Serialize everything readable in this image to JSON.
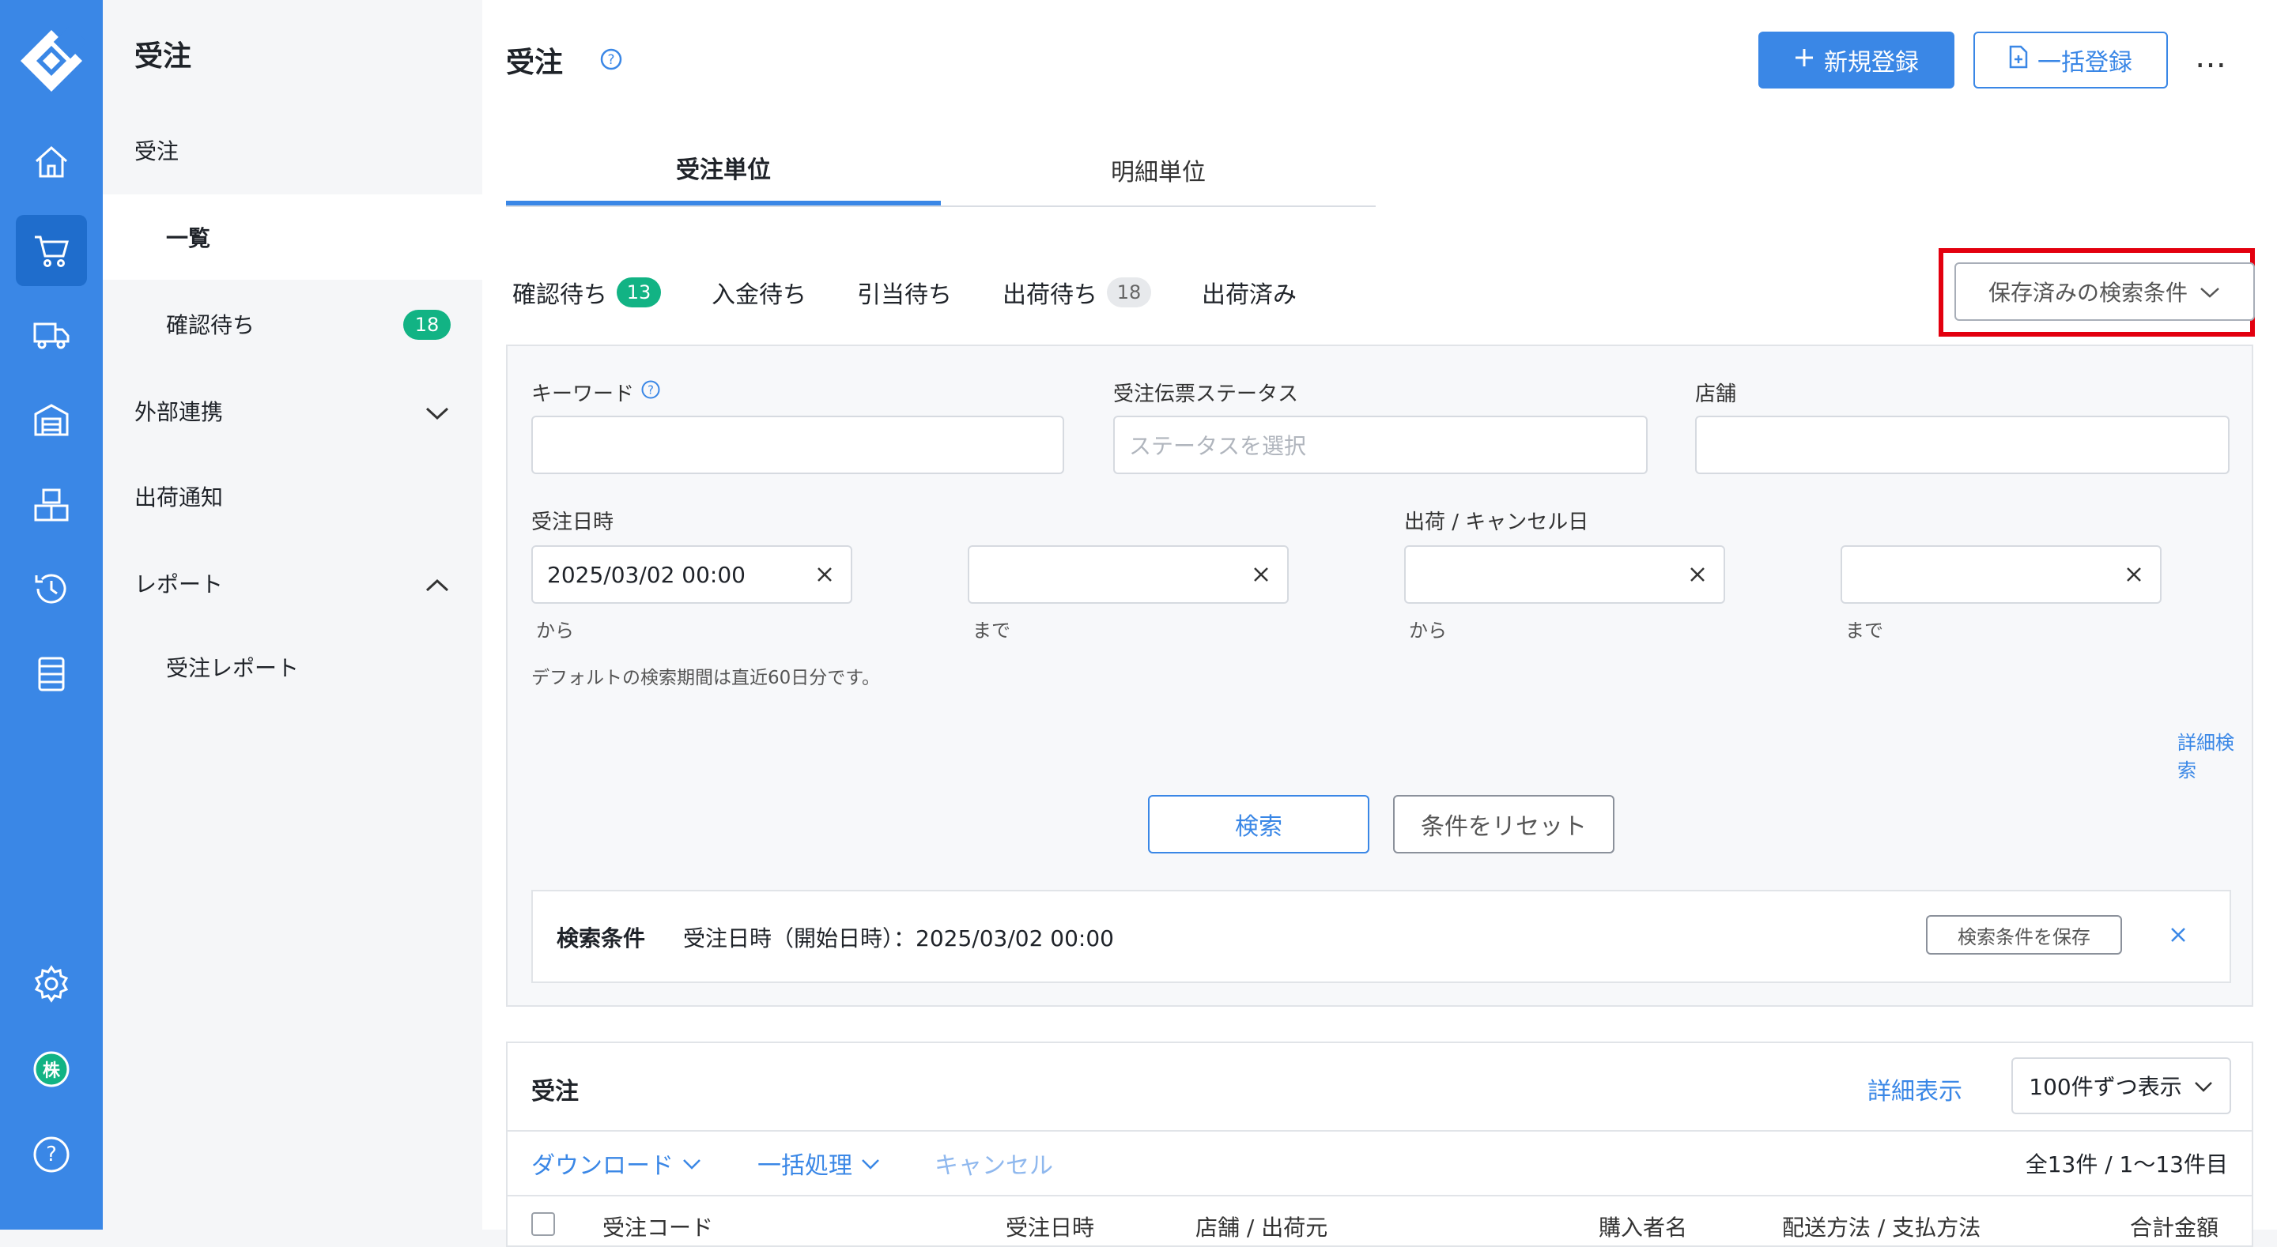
{
  "sidebar": {
    "title": "受注",
    "items": [
      {
        "label": "受注"
      },
      {
        "label": "一覧"
      },
      {
        "label": "確認待ち",
        "badge": "18"
      },
      {
        "label": "外部連携"
      },
      {
        "label": "出荷通知"
      },
      {
        "label": "レポート"
      },
      {
        "label": "受注レポート"
      }
    ]
  },
  "rail": {
    "logo": "app-logo",
    "icons": [
      "home-icon",
      "cart-icon",
      "truck-icon",
      "warehouse-icon",
      "boxes-icon",
      "history-icon",
      "server-icon",
      "gear-icon",
      "company-avatar",
      "help-icon"
    ],
    "company_avatar_label": "株",
    "help_label": "?"
  },
  "header": {
    "title": "受注",
    "new_button": "新規登録",
    "bulk_button": "一括登録",
    "more": "…"
  },
  "tabs": [
    {
      "label": "受注単位",
      "active": true
    },
    {
      "label": "明細単位",
      "active": false
    }
  ],
  "status_tabs": [
    {
      "label": "確認待ち",
      "count": "13",
      "style": "green"
    },
    {
      "label": "入金待ち"
    },
    {
      "label": "引当待ち"
    },
    {
      "label": "出荷待ち",
      "count": "18",
      "style": "gray"
    },
    {
      "label": "出荷済み"
    }
  ],
  "saved_search": {
    "label": "保存済みの検索条件"
  },
  "search": {
    "keyword_label": "キーワード",
    "keyword_value": "",
    "status_label": "受注伝票ステータス",
    "status_placeholder": "ステータスを選択",
    "store_label": "店舗",
    "store_value": "",
    "order_date_label": "受注日時",
    "order_date_from": "2025/03/02 00:00",
    "order_date_to": "",
    "ship_date_label": "出荷 / キャンセル日",
    "ship_date_from": "",
    "ship_date_to": "",
    "from_label": "から",
    "to_label": "まで",
    "default_hint": "デフォルトの検索期間は直近60日分です。",
    "advanced_link": "詳細検索",
    "search_button": "検索",
    "reset_button": "条件をリセット",
    "conditions_label": "検索条件",
    "conditions_text": "受注日時（開始日時）：2025/03/02 00:00",
    "save_conditions_button": "検索条件を保存"
  },
  "orders": {
    "title": "受注",
    "detail_link": "詳細表示",
    "per_page": "100件ずつ表示",
    "download": "ダウンロード",
    "bulk_action": "一括処理",
    "cancel": "キャンセル",
    "range": "全13件 / 1〜13件目",
    "columns": [
      "受注コード",
      "受注日時",
      "店舗 / 出荷元",
      "購入者名",
      "配送方法 / 支払方法",
      "合計金額"
    ]
  },
  "colors": {
    "primary": "#3a87e6",
    "rail": "#3a87e6",
    "badge_green": "#12b384",
    "highlight": "#e3000f"
  }
}
